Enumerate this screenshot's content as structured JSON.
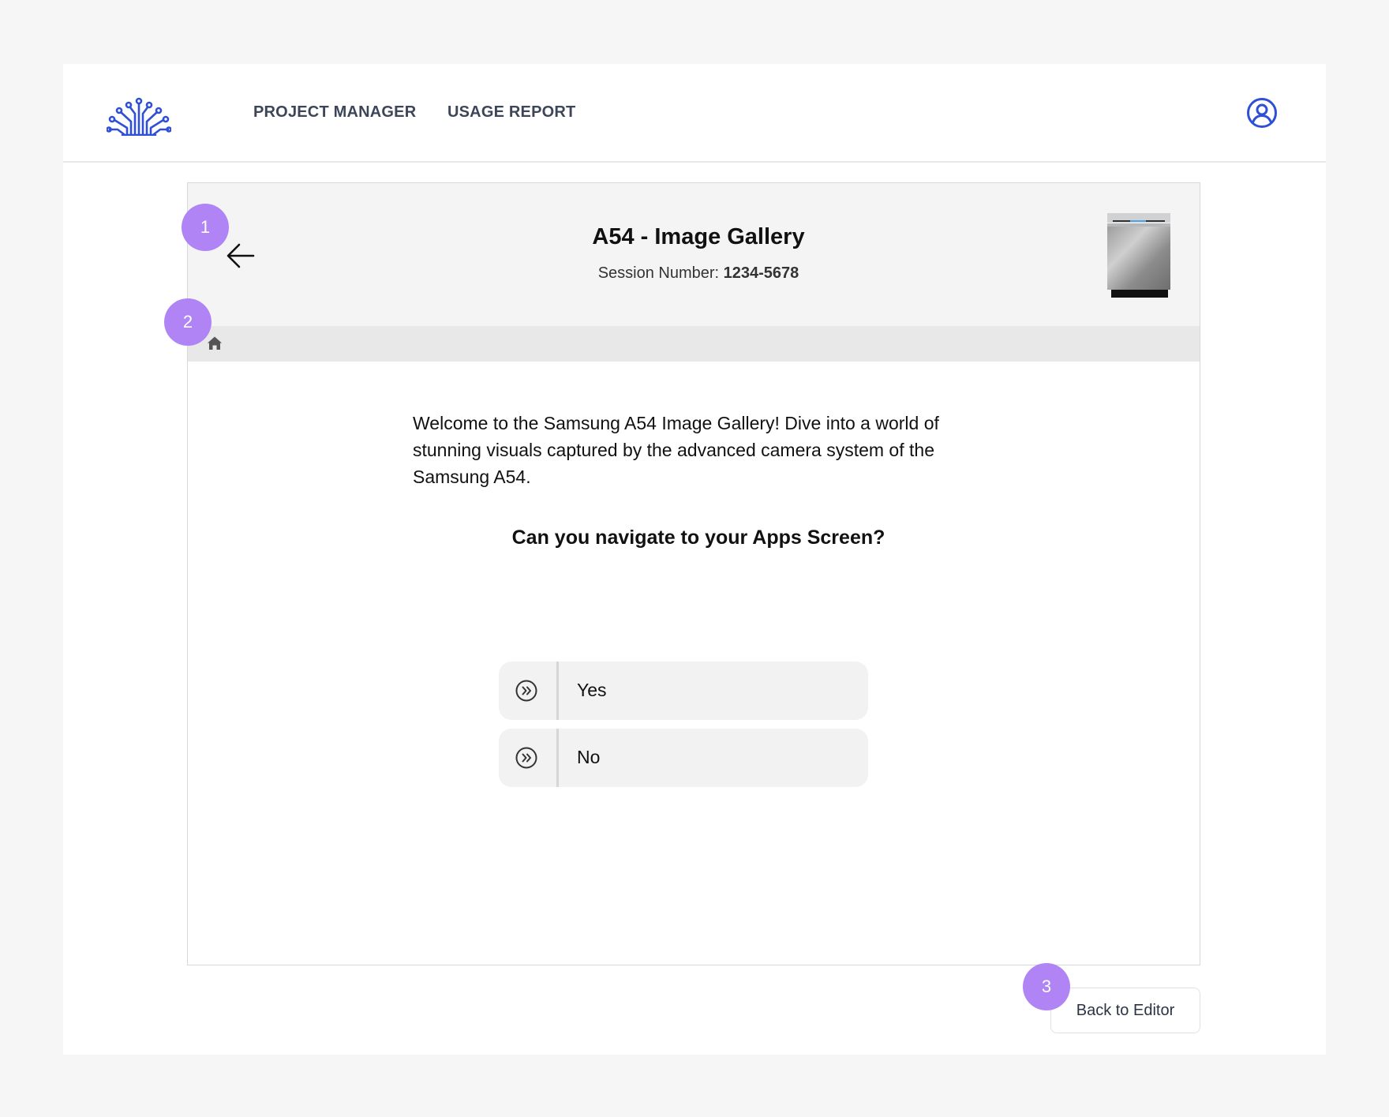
{
  "nav": {
    "logo": "tree-circuit-logo",
    "links": [
      "PROJECT MANAGER",
      "USAGE REPORT"
    ],
    "user_icon": "user-circle-icon",
    "accent_color": "#2f4fd6"
  },
  "preview": {
    "title": "A54 - Image Gallery",
    "session_label": "Session Number: ",
    "session_number": "1234-5678",
    "back_icon": "arrow-left-icon",
    "home_icon": "home-icon",
    "device_image": "dishwasher-image",
    "intro": "Welcome to the Samsung A54 Image Gallery! Dive into a world of stunning visuals captured by the advanced camera system of the Samsung A54.",
    "question": "Can you navigate to your Apps Screen?",
    "options": [
      {
        "label": "Yes",
        "icon": "double-chevron-right-circle-icon"
      },
      {
        "label": "No",
        "icon": "double-chevron-right-circle-icon"
      }
    ]
  },
  "footer": {
    "back_to_editor": "Back to Editor"
  },
  "markers": [
    "1",
    "2",
    "3"
  ],
  "marker_color": "#b084f5"
}
